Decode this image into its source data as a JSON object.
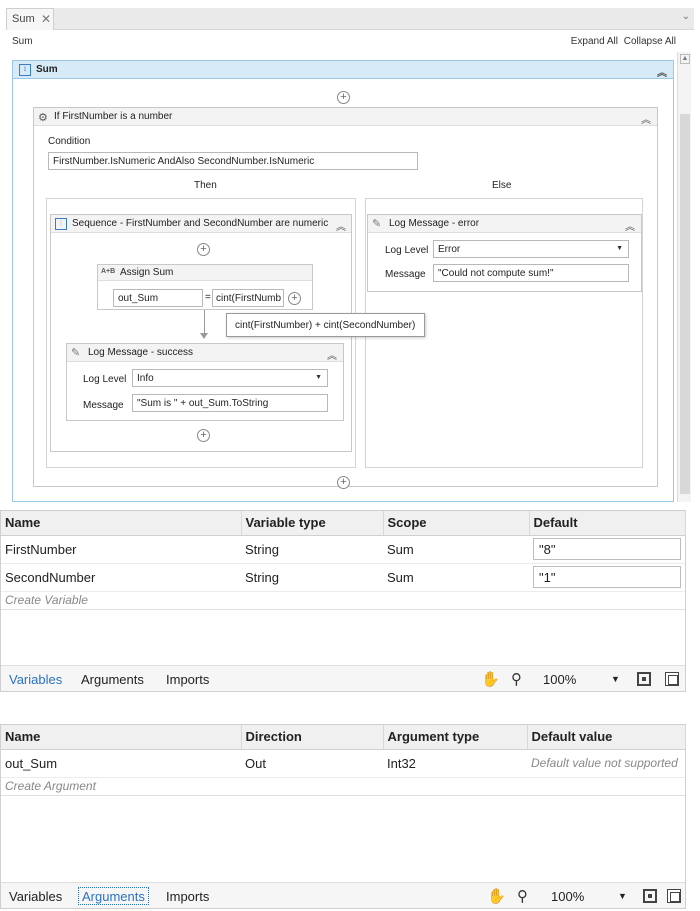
{
  "tab": {
    "label": "Sum",
    "close": "✕",
    "menu": "⌄"
  },
  "breadcrumb": {
    "label": "Sum",
    "expand_all": "Expand All",
    "collapse_all": "Collapse All"
  },
  "outer_sequence": {
    "title": "Sum",
    "collapse": "≈"
  },
  "if_activity": {
    "title": "If FirstNumber is a number",
    "condition_label": "Condition",
    "condition": "FirstNumber.IsNumeric AndAlso SecondNumber.IsNumeric",
    "then_label": "Then",
    "else_label": "Else"
  },
  "then_sequence": {
    "title": "Sequence - FirstNumber and SecondNumber are numeric"
  },
  "assign": {
    "icon": "A+B",
    "title": "Assign Sum",
    "to": "out_Sum",
    "equals": "=",
    "value": "cint(FirstNumb",
    "tooltip": "cint(FirstNumber) + cint(SecondNumber)"
  },
  "log_success": {
    "title": "Log Message - success",
    "level_label": "Log Level",
    "level": "Info",
    "message_label": "Message",
    "message": "\"Sum is \" + out_Sum.ToString"
  },
  "log_error": {
    "title": "Log Message - error",
    "level_label": "Log Level",
    "level": "Error",
    "message_label": "Message",
    "message": "\"Could not compute sum!\""
  },
  "variables": {
    "columns": [
      "Name",
      "Variable type",
      "Scope",
      "Default"
    ],
    "rows": [
      [
        "FirstNumber",
        "String",
        "Sum",
        "\"8\""
      ],
      [
        "SecondNumber",
        "String",
        "Sum",
        "\"1\""
      ]
    ],
    "create_label": "Create Variable"
  },
  "arguments": {
    "columns": [
      "Name",
      "Direction",
      "Argument type",
      "Default value"
    ],
    "rows": [
      [
        "out_Sum",
        "Out",
        "Int32",
        "Default value not supported"
      ]
    ],
    "create_label": "Create Argument"
  },
  "bottom_tabs": {
    "variables": "Variables",
    "arguments": "Arguments",
    "imports": "Imports"
  },
  "zoom": "100%",
  "icons": {
    "hand": "hand-icon",
    "search": "search-icon",
    "fit": "fit-screen-icon",
    "overview": "overview-icon"
  },
  "colors": {
    "accent": "#2a72c4",
    "sequence_header": "#d6eaf8"
  }
}
